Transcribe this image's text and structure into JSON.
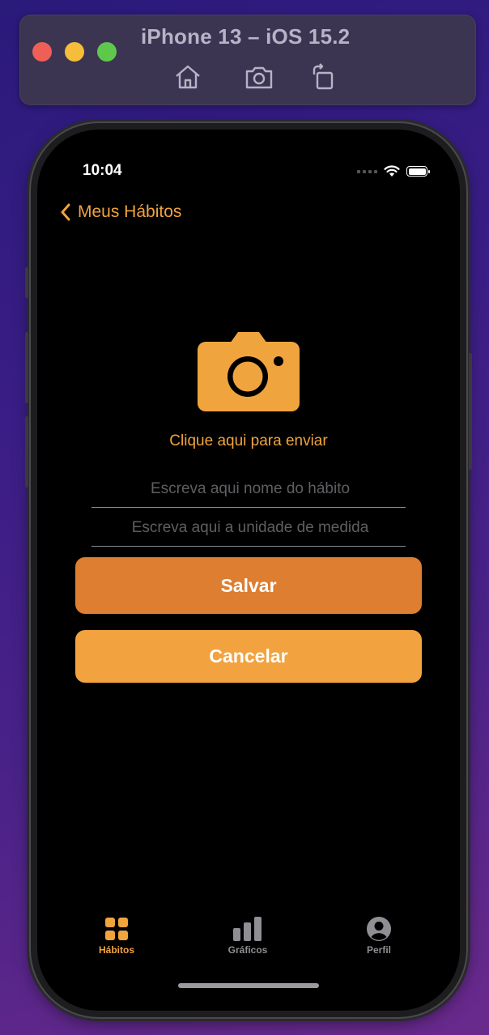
{
  "simulator": {
    "title": "iPhone 13 – iOS 15.2",
    "buttons": [
      "home-icon",
      "screenshot-icon",
      "rotate-icon"
    ]
  },
  "status_bar": {
    "time": "10:04"
  },
  "nav": {
    "back_label": "Meus Hábitos"
  },
  "form": {
    "upload_label": "Clique aqui para enviar",
    "habit_name": {
      "value": "",
      "placeholder": "Escreva aqui nome do hábito"
    },
    "unit": {
      "value": "",
      "placeholder": "Escreva aqui a unidade de medida"
    },
    "save_label": "Salvar",
    "cancel_label": "Cancelar"
  },
  "tabbar": {
    "items": [
      {
        "label": "Hábitos",
        "icon": "grid-icon",
        "active": true
      },
      {
        "label": "Gráficos",
        "icon": "bar-chart-icon",
        "active": false
      },
      {
        "label": "Perfil",
        "icon": "profile-icon",
        "active": false
      }
    ]
  },
  "colors": {
    "accent": "#f0a43e",
    "save_button": "#dd7e30",
    "cancel_button": "#f2a33f",
    "screen_bg": "#000000"
  }
}
